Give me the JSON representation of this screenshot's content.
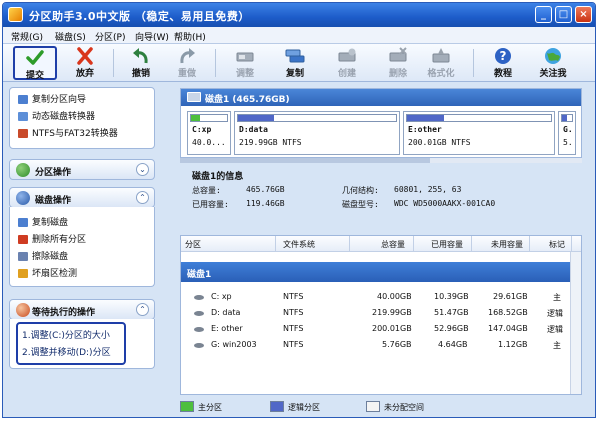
{
  "window": {
    "title": "分区助手3.0中文版 （稳定、易用且免费）",
    "controls": {
      "minimize": "_",
      "maximize": "□",
      "close": "×"
    }
  },
  "menu": [
    "常规(G)",
    "磁盘(S)",
    "分区(P)",
    "向导(W)",
    "帮助(H)"
  ],
  "toolbar": {
    "buttons": [
      {
        "label": "提交",
        "icon": "check-icon",
        "enabled": true
      },
      {
        "label": "放弃",
        "icon": "x-icon",
        "enabled": true
      },
      {
        "label": "撤销",
        "icon": "undo-icon",
        "enabled": true
      },
      {
        "label": "重做",
        "icon": "redo-icon",
        "enabled": false
      },
      {
        "label": "调整",
        "icon": "resize-icon",
        "enabled": false
      },
      {
        "label": "复制",
        "icon": "copy-disk-icon",
        "enabled": true
      },
      {
        "label": "创建",
        "icon": "create-icon",
        "enabled": false
      },
      {
        "label": "删除",
        "icon": "delete-icon",
        "enabled": false
      },
      {
        "label": "格式化",
        "icon": "format-icon",
        "enabled": false
      },
      {
        "label": "教程",
        "icon": "help-icon",
        "enabled": true
      },
      {
        "label": "关注我",
        "icon": "globe-icon",
        "enabled": true
      }
    ]
  },
  "left_panel": {
    "wizards": [
      "复制分区向导",
      "动态磁盘转换器",
      "NTFS与FAT32转换器"
    ],
    "partition_ops": {
      "title": "分区操作"
    },
    "disk_ops": {
      "title": "磁盘操作",
      "items": [
        "复制磁盘",
        "删除所有分区",
        "擦除磁盘",
        "坏扇区检测"
      ]
    },
    "pending": {
      "title": "等待执行的操作",
      "items": [
        "1.调整(C:)分区的大小",
        "2.调整并移动(D:)分区"
      ]
    }
  },
  "disk_map": {
    "header": "磁盘1 (465.76GB)",
    "partitions": [
      {
        "name": "C:xp",
        "size": "40.0...",
        "used_fraction": 0.26,
        "color": "#4dbf3d"
      },
      {
        "name": "D:data",
        "size": "219.99GB NTFS",
        "used_fraction": 0.23,
        "color": "#5067c7"
      },
      {
        "name": "E:other",
        "size": "200.01GB NTFS",
        "used_fraction": 0.26,
        "color": "#5067c7"
      },
      {
        "name": "G.",
        "size": "5.",
        "used_fraction": 0.5,
        "color": "#5067c7"
      }
    ]
  },
  "disk_info": {
    "title": "磁盘1的信息",
    "total_label": "总容量:",
    "total_value": "465.76GB",
    "used_label": "已用容量:",
    "used_value": "119.46GB",
    "geometry_label": "几何结构:",
    "geometry_value": "60801, 255, 63",
    "model_label": "磁盘型号:",
    "model_value": "WDC WD5000AAKX-001CA0"
  },
  "partition_table": {
    "columns": [
      "分区",
      "文件系统",
      "总容量",
      "已用容量",
      "未用容量",
      "标记"
    ],
    "disk_row": "磁盘1",
    "rows": [
      [
        "C: xp",
        "NTFS",
        "40.00GB",
        "10.39GB",
        "29.61GB",
        "主"
      ],
      [
        "D: data",
        "NTFS",
        "219.99GB",
        "51.47GB",
        "168.52GB",
        "逻辑"
      ],
      [
        "E: other",
        "NTFS",
        "200.01GB",
        "52.96GB",
        "147.04GB",
        "逻辑"
      ],
      [
        "G: win2003",
        "NTFS",
        "5.76GB",
        "4.64GB",
        "1.12GB",
        "主"
      ]
    ]
  },
  "legend": {
    "primary": "主分区",
    "logical": "逻辑分区",
    "unallocated": "未分配空间"
  },
  "colors": {
    "primary": "#4dbf3d",
    "logical": "#5067c7",
    "accent": "#2a5fb7",
    "highlight_border": "#1e3ea8"
  }
}
